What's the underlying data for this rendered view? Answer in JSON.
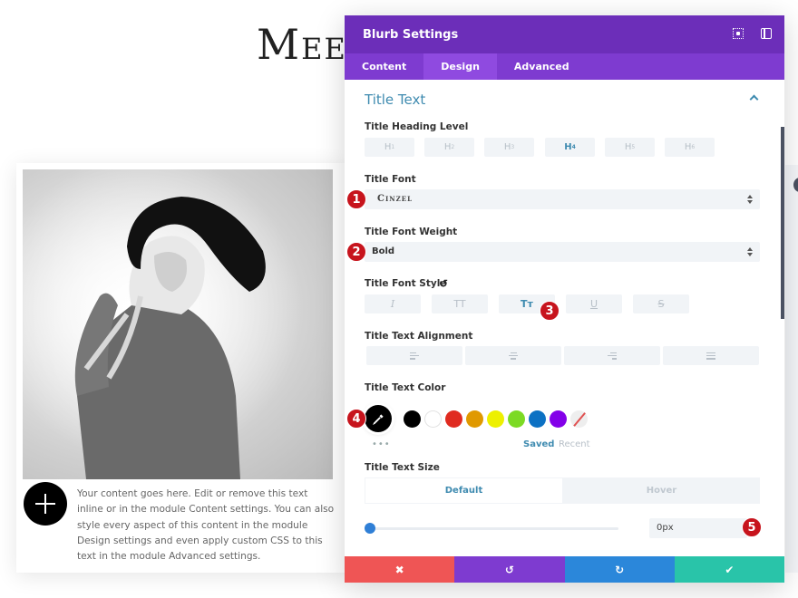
{
  "page": {
    "heading": "Meet",
    "blurb_text": "Your content goes here. Edit or remove this text inline or in the module Content settings. You can also style every aspect of this content in the module Design settings and even apply custom CSS to this text in the module Advanced settings.",
    "blurb_icon": "plus-icon"
  },
  "modal": {
    "title": "Blurb Settings",
    "header_icons": [
      "fullscreen-icon",
      "sidebar-toggle-icon"
    ],
    "tabs": [
      {
        "label": "Content",
        "active": false
      },
      {
        "label": "Design",
        "active": true
      },
      {
        "label": "Advanced",
        "active": false
      }
    ],
    "section": {
      "title": "Title Text",
      "heading_level": {
        "label": "Title Heading Level",
        "options": [
          {
            "letter": "H",
            "num": "1"
          },
          {
            "letter": "H",
            "num": "2"
          },
          {
            "letter": "H",
            "num": "3"
          },
          {
            "letter": "H",
            "num": "4"
          },
          {
            "letter": "H",
            "num": "5"
          },
          {
            "letter": "H",
            "num": "6"
          }
        ],
        "selected": "H4"
      },
      "font": {
        "label": "Title Font",
        "value": "Cinzel"
      },
      "font_weight": {
        "label": "Title Font Weight",
        "value": "Bold"
      },
      "font_style": {
        "label": "Title Font Style",
        "reset_icon": "reset-icon",
        "options": [
          {
            "glyph": "I",
            "name": "italic",
            "active": false
          },
          {
            "glyph": "TT",
            "name": "uppercase",
            "active": false
          },
          {
            "glyph": "Tт",
            "name": "capitalize",
            "active": true
          },
          {
            "glyph": "U",
            "name": "underline",
            "active": false
          },
          {
            "glyph": "S",
            "name": "strikethrough",
            "active": false
          }
        ]
      },
      "alignment": {
        "label": "Title Text Alignment",
        "options": [
          "left",
          "center",
          "right",
          "justify"
        ]
      },
      "text_color": {
        "label": "Title Text Color",
        "current": "#000000",
        "swatches": [
          "#000000",
          "#ffffff",
          "#e02b20",
          "#e09900",
          "#edf000",
          "#7cda24",
          "#0c71c3",
          "#8300e9",
          "none"
        ],
        "saved_label": "Saved",
        "recent_label": "Recent",
        "more_label": "•••"
      },
      "text_size": {
        "label": "Title Text Size",
        "tabs": [
          "Default",
          "Hover"
        ],
        "active_tab": "Default",
        "value": "0px",
        "slider_fraction": 0
      }
    },
    "markers": [
      "1",
      "2",
      "3",
      "4",
      "5"
    ],
    "footer": {
      "cancel": "✖",
      "undo": "↺",
      "redo": "↻",
      "save": "✔"
    }
  },
  "colors": {
    "header": "#6c2eb9",
    "tabs": "#7e3bd0",
    "accent": "#3f8bb0",
    "cancel": "#ef5555",
    "undo": "#7e3bd0",
    "redo": "#2b87da",
    "save": "#29c4a9",
    "marker": "#c7141d"
  }
}
